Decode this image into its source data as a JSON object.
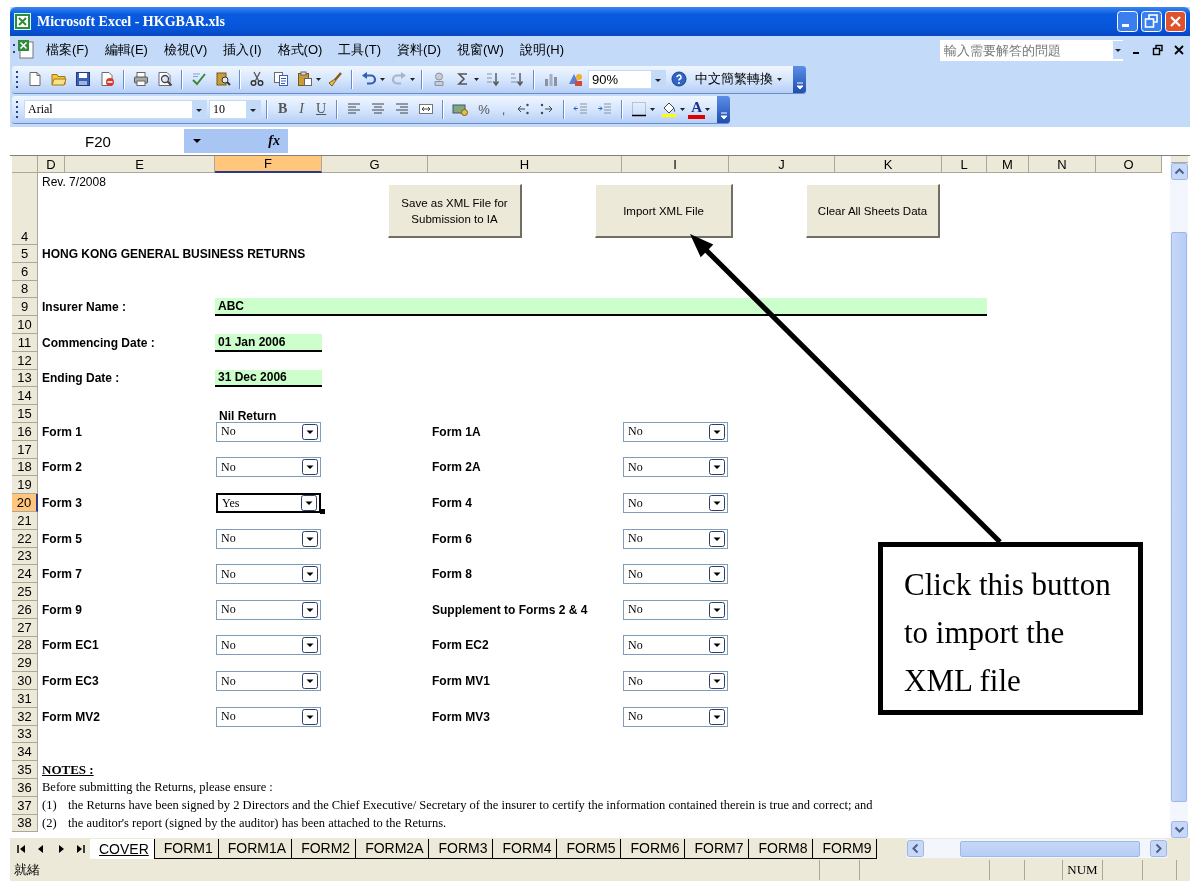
{
  "window": {
    "title": "Microsoft Excel - HKGBAR.xls"
  },
  "menu": {
    "items": [
      "檔案(F)",
      "編輯(E)",
      "檢視(V)",
      "插入(I)",
      "格式(O)",
      "工具(T)",
      "資料(D)",
      "視窗(W)",
      "說明(H)"
    ],
    "help_search": {
      "placeholder": "輸入需要解答的問題"
    }
  },
  "standard_toolbar": {
    "zoom": "90%",
    "conversion": "中文簡繁轉換"
  },
  "formatting_toolbar": {
    "font": "Arial",
    "size": "10",
    "style_buttons": [
      "B",
      "I",
      "U"
    ],
    "number_buttons": [
      "%",
      ","
    ],
    "font_color": "A"
  },
  "formula_bar": {
    "name_box": "F20",
    "function_button": "fx"
  },
  "columns": [
    {
      "label": "D",
      "selected": false
    },
    {
      "label": "E",
      "selected": false
    },
    {
      "label": "F",
      "selected": true
    },
    {
      "label": "G",
      "selected": false
    },
    {
      "label": "H",
      "selected": false
    },
    {
      "label": "I",
      "selected": false
    },
    {
      "label": "J",
      "selected": false
    },
    {
      "label": "K",
      "selected": false
    },
    {
      "label": "L",
      "selected": false
    },
    {
      "label": "M",
      "selected": false
    },
    {
      "label": "N",
      "selected": false
    },
    {
      "label": "O",
      "selected": false
    }
  ],
  "rows": [
    {
      "label": "4",
      "selected": false
    },
    {
      "label": "5",
      "selected": false
    },
    {
      "label": "6",
      "selected": false
    },
    {
      "label": "8",
      "selected": false
    },
    {
      "label": "9",
      "selected": false
    },
    {
      "label": "10",
      "selected": false
    },
    {
      "label": "11",
      "selected": false
    },
    {
      "label": "12",
      "selected": false
    },
    {
      "label": "13",
      "selected": false
    },
    {
      "label": "14",
      "selected": false
    },
    {
      "label": "15",
      "selected": false
    },
    {
      "label": "16",
      "selected": false
    },
    {
      "label": "17",
      "selected": false
    },
    {
      "label": "18",
      "selected": false
    },
    {
      "label": "19",
      "selected": false
    },
    {
      "label": "20",
      "selected": true
    },
    {
      "label": "21",
      "selected": false
    },
    {
      "label": "22",
      "selected": false
    },
    {
      "label": "23",
      "selected": false
    },
    {
      "label": "24",
      "selected": false
    },
    {
      "label": "25",
      "selected": false
    },
    {
      "label": "26",
      "selected": false
    },
    {
      "label": "27",
      "selected": false
    },
    {
      "label": "28",
      "selected": false
    },
    {
      "label": "29",
      "selected": false
    },
    {
      "label": "30",
      "selected": false
    },
    {
      "label": "31",
      "selected": false
    },
    {
      "label": "32",
      "selected": false
    },
    {
      "label": "33",
      "selected": false
    },
    {
      "label": "34",
      "selected": false
    },
    {
      "label": "35",
      "selected": false
    },
    {
      "label": "36",
      "selected": false
    },
    {
      "label": "37",
      "selected": false
    },
    {
      "label": "38",
      "selected": false
    }
  ],
  "sheet": {
    "revision": "Rev. 7/2008",
    "title": "HONG KONG GENERAL BUSINESS RETURNS",
    "buttons": [
      "Save as XML File for Submission to IA",
      "Import XML File",
      "Clear All Sheets Data"
    ],
    "fields": [
      {
        "label": "Insurer Name :",
        "value": "ABC"
      },
      {
        "label": "Commencing Date :",
        "value": "01 Jan 2006"
      },
      {
        "label": "Ending Date :",
        "value": "31 Dec 2006"
      }
    ],
    "nil_return_header": "Nil Return",
    "form_rows": [
      {
        "left": {
          "label": "Form 1",
          "value": "No",
          "selected": false
        },
        "right": {
          "label": "Form 1A",
          "value": "No",
          "selected": false
        }
      },
      {
        "left": {
          "label": "Form 2",
          "value": "No",
          "selected": false
        },
        "right": {
          "label": "Form 2A",
          "value": "No",
          "selected": false
        }
      },
      {
        "left": {
          "label": "Form 3",
          "value": "Yes",
          "selected": true
        },
        "right": {
          "label": "Form 4",
          "value": "No",
          "selected": false
        }
      },
      {
        "left": {
          "label": "Form 5",
          "value": "No",
          "selected": false
        },
        "right": {
          "label": "Form 6",
          "value": "No",
          "selected": false
        }
      },
      {
        "left": {
          "label": "Form 7",
          "value": "No",
          "selected": false
        },
        "right": {
          "label": "Form 8",
          "value": "No",
          "selected": false
        }
      },
      {
        "left": {
          "label": "Form 9",
          "value": "No",
          "selected": false
        },
        "right": {
          "label": "Supplement to Forms 2 & 4",
          "value": "No",
          "selected": false
        }
      },
      {
        "left": {
          "label": "Form EC1",
          "value": "No",
          "selected": false
        },
        "right": {
          "label": "Form EC2",
          "value": "No",
          "selected": false
        }
      },
      {
        "left": {
          "label": "Form EC3",
          "value": "No",
          "selected": false
        },
        "right": {
          "label": "Form MV1",
          "value": "No",
          "selected": false
        }
      },
      {
        "left": {
          "label": "Form MV2",
          "value": "No",
          "selected": false
        },
        "right": {
          "label": "Form MV3",
          "value": "No",
          "selected": false
        }
      }
    ],
    "notes": {
      "heading": "NOTES :",
      "intro": "Before submitting the Returns, please ensure :",
      "items": [
        {
          "number": "(1)",
          "text": "the Returns have been signed by 2 Directors and the Chief Executive/ Secretary of the insurer to certify the information contained therein is true and correct; and"
        },
        {
          "number": "(2)",
          "text": "the auditor's report (signed by the auditor) has been attached to the Returns."
        }
      ]
    }
  },
  "callout": {
    "text": "Click this button to import the XML file"
  },
  "sheet_tabs": [
    {
      "label": "COVER",
      "selected": true
    },
    {
      "label": "FORM1",
      "selected": false
    },
    {
      "label": "FORM1A",
      "selected": false
    },
    {
      "label": "FORM2",
      "selected": false
    },
    {
      "label": "FORM2A",
      "selected": false
    },
    {
      "label": "FORM3",
      "selected": false
    },
    {
      "label": "FORM4",
      "selected": false
    },
    {
      "label": "FORM5",
      "selected": false
    },
    {
      "label": "FORM6",
      "selected": false
    },
    {
      "label": "FORM7",
      "selected": false
    },
    {
      "label": "FORM8",
      "selected": false
    },
    {
      "label": "FORM9",
      "selected": false
    }
  ],
  "status_bar": {
    "status": "就緒",
    "indicators": [
      "NUM"
    ]
  }
}
